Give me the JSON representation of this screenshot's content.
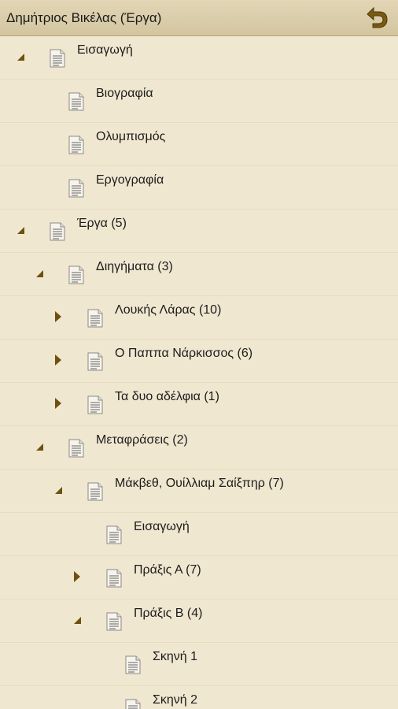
{
  "header": {
    "title": "Δημήτριος Βικέλας (Έργα)",
    "back_icon": "back-arrow-icon"
  },
  "colors": {
    "background": "#f0e7d0",
    "header": "#d8cba8",
    "toggle_arrow": "#7a5a12"
  },
  "tree": {
    "items": [
      {
        "label": "Εισαγωγή",
        "level": 0,
        "state": "expanded"
      },
      {
        "label": "Βιογραφία",
        "level": 1,
        "state": "leaf"
      },
      {
        "label": "Ολυμπισμός",
        "level": 1,
        "state": "leaf"
      },
      {
        "label": "Εργογραφία",
        "level": 1,
        "state": "leaf"
      },
      {
        "label": "Έργα (5)",
        "level": 0,
        "state": "expanded"
      },
      {
        "label": "Διηγήματα (3)",
        "level": 1,
        "state": "expanded"
      },
      {
        "label": "Λουκής Λάρας (10)",
        "level": 2,
        "state": "collapsed"
      },
      {
        "label": "Ο Παππα Νάρκισσος (6)",
        "level": 2,
        "state": "collapsed"
      },
      {
        "label": "Τα δυο αδέλφια (1)",
        "level": 2,
        "state": "collapsed"
      },
      {
        "label": "Μεταφράσεις (2)",
        "level": 1,
        "state": "expanded"
      },
      {
        "label": "Μάκβεθ, Ουίλλιαμ Σαίξπηρ (7)",
        "level": 2,
        "state": "expanded"
      },
      {
        "label": "Εισαγωγή",
        "level": 3,
        "state": "leaf"
      },
      {
        "label": "Πράξις Α (7)",
        "level": 3,
        "state": "collapsed"
      },
      {
        "label": "Πράξις Β (4)",
        "level": 3,
        "state": "expanded"
      },
      {
        "label": "Σκηνή 1",
        "level": 4,
        "state": "leaf"
      },
      {
        "label": "Σκηνή 2",
        "level": 4,
        "state": "leaf"
      }
    ]
  }
}
